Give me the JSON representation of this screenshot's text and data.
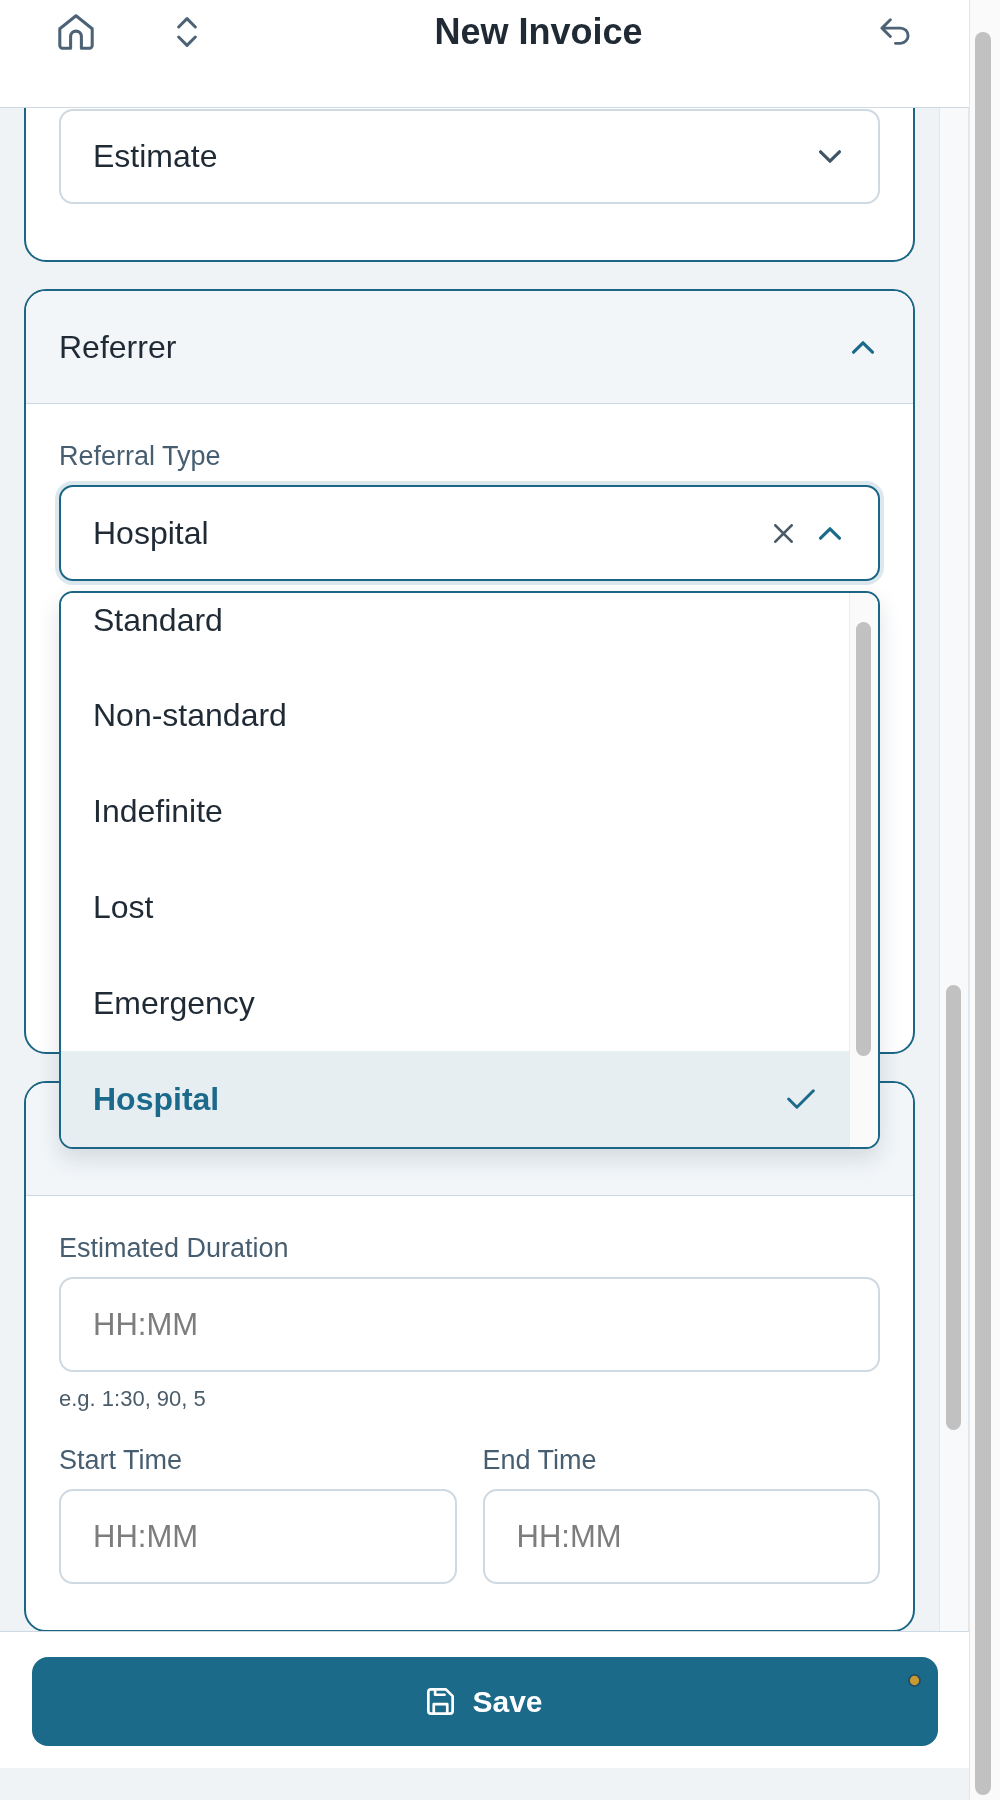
{
  "header": {
    "title": "New Invoice"
  },
  "sections": [
    {
      "kind": "cut",
      "fields": [
        {
          "kind": "select",
          "value": "Estimate",
          "expanded": false,
          "clearable": false
        }
      ]
    },
    {
      "kind": "titled",
      "title": "Referrer",
      "expanded": true,
      "fields": [
        {
          "kind": "select",
          "label": "Referral Type",
          "value": "Hospital",
          "expanded": true,
          "clearable": true,
          "options": [
            {
              "label": "Standard",
              "selected": false
            },
            {
              "label": "Non-standard",
              "selected": false
            },
            {
              "label": "Indefinite",
              "selected": false
            },
            {
              "label": "Lost",
              "selected": false
            },
            {
              "label": "Emergency",
              "selected": false
            },
            {
              "label": "Hospital",
              "selected": true
            }
          ]
        }
      ]
    },
    {
      "kind": "covered",
      "fields": [
        {
          "kind": "text",
          "label": "Estimated Duration",
          "placeholder": "HH:MM",
          "hint": "e.g. 1:30, 90, 5"
        },
        {
          "kind": "pair",
          "items": [
            {
              "label": "Start Time",
              "placeholder": "HH:MM"
            },
            {
              "label": "End Time",
              "placeholder": "HH:MM"
            }
          ]
        }
      ]
    }
  ],
  "save_button": {
    "label": "Save",
    "status_dot": true
  }
}
